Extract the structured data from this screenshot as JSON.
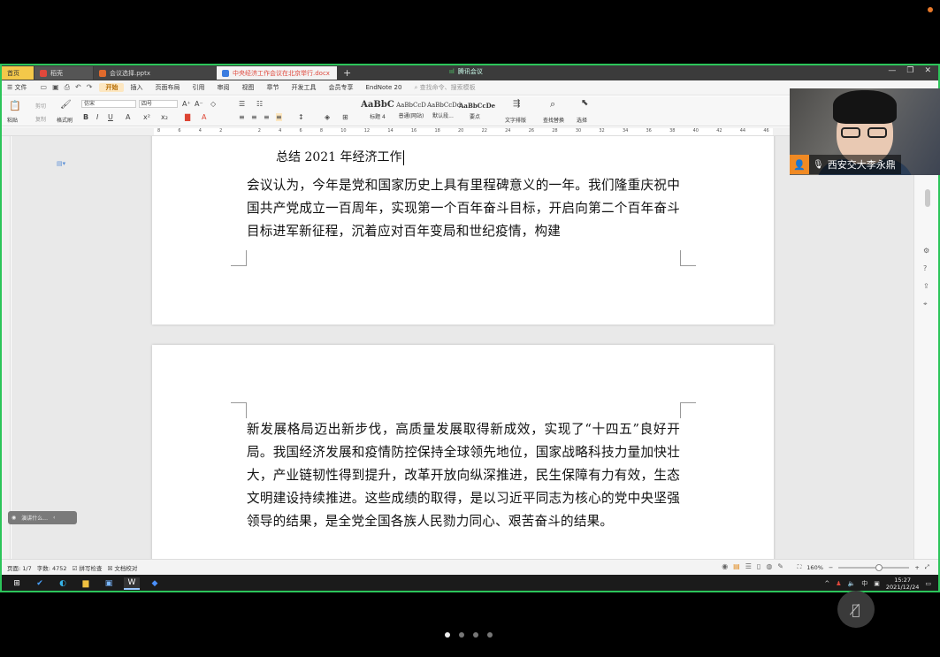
{
  "tabs": {
    "home": "首页",
    "doc": "稻壳",
    "ppt": "会议选择.pptx",
    "active": "中央经济工作会议在北京举行.docx",
    "plus": "+"
  },
  "meeting": {
    "signal": "ııl",
    "status": "腾讯会议"
  },
  "menu": {
    "file": "☰ 文件",
    "items": [
      "开始",
      "插入",
      "页面布局",
      "引用",
      "审阅",
      "视图",
      "章节",
      "开发工具",
      "会员专享",
      "EndNote 20"
    ],
    "search": "查找命令、搜索模板"
  },
  "ribbon": {
    "paste": "粘贴",
    "format_painter": "格式刷",
    "cut": "剪切",
    "copy": "复制",
    "font": "仿宋",
    "size": "四号",
    "styles": [
      {
        "sample": "AaBbC",
        "label": "标题 4"
      },
      {
        "sample": "AaBbCcD",
        "label": "普通(网站)"
      },
      {
        "sample": "AaBbCcDd",
        "label": "默认段..."
      },
      {
        "sample": "AaBbCcDe",
        "label": "要点"
      }
    ],
    "text_layout": "文字排版",
    "find_replace": "查找替换",
    "select": "选择"
  },
  "ruler": [
    "8",
    "6",
    "4",
    "2",
    "",
    "2",
    "4",
    "6",
    "8",
    "10",
    "12",
    "14",
    "16",
    "18",
    "20",
    "22",
    "24",
    "26",
    "28",
    "30",
    "32",
    "34",
    "36",
    "38",
    "40",
    "42",
    "44",
    "46"
  ],
  "document": {
    "heading": "总结 2021 年经济工作",
    "paragraph1": "会议认为，今年是党和国家历史上具有里程碑意义的一年。我们隆重庆祝中国共产党成立一百周年，实现第一个百年奋斗目标，开启向第二个百年奋斗目标进军新征程，沉着应对百年变局和世纪疫情，构建",
    "paragraph2": "新发展格局迈出新步伐，高质量发展取得新成效，实现了“十四五”良好开局。我国经济发展和疫情防控保持全球领先地位，国家战略科技力量加快壮大，产业链韧性得到提升，改革开放向纵深推进，民生保障有力有效，生态文明建设持续推进。这些成绩的取得，是以习近平同志为核心的党中央坚强领导的结果，是全党全国各族人民勠力同心、艰苦奋斗的结果。"
  },
  "floatbar": {
    "label": "演讲什么..."
  },
  "status": {
    "page": "页面: 1/7",
    "words": "字数: 4752",
    "spell": "拼写检查",
    "proof": "文档校对",
    "zoom": "160%"
  },
  "taskbar": {
    "time": "15:27",
    "date": "2021/12/24",
    "ime": "中"
  },
  "video": {
    "participant_name": "西安交大李永鼎"
  },
  "colors": {
    "share_border": "#2cc55a",
    "active_menu": "#b56b00",
    "name_icon": "#f08a24"
  }
}
